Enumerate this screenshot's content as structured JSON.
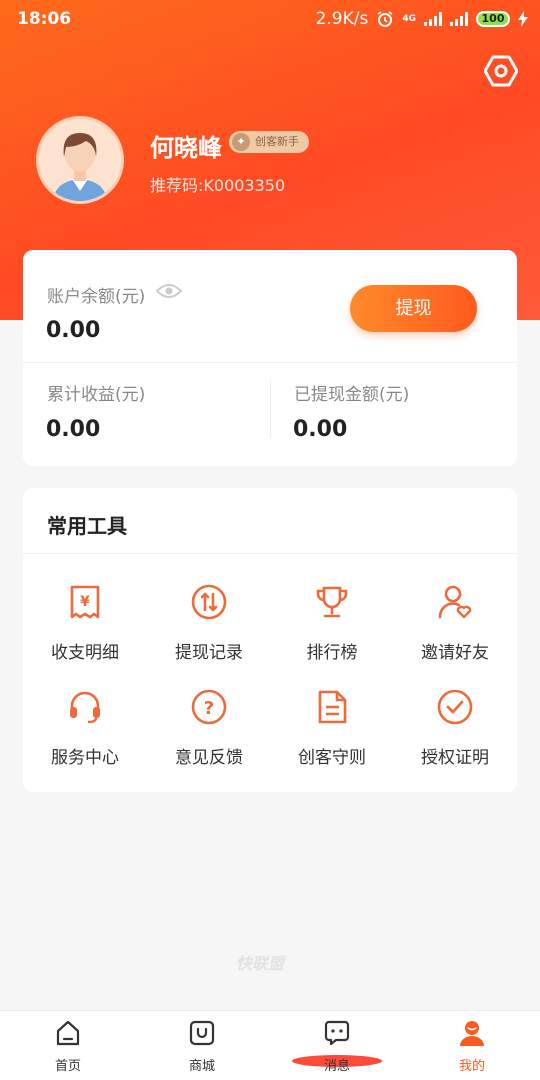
{
  "status_bar": {
    "time": "18:06",
    "network_speed": "2.9K/s",
    "network_type": "4G",
    "battery": "100"
  },
  "profile": {
    "name": "何晓峰",
    "badge": "创客新手",
    "referral_code": "推荐码:K0003350"
  },
  "balance": {
    "account_label": "账户余额(元)",
    "account_value": "0.00",
    "withdraw_button": "提现",
    "total_income_label": "累计收益(元)",
    "total_income_value": "0.00",
    "withdrawn_label": "已提现金额(元)",
    "withdrawn_value": "0.00"
  },
  "tools": {
    "title": "常用工具",
    "items": [
      {
        "label": "收支明细",
        "icon": "receipt-icon"
      },
      {
        "label": "提现记录",
        "icon": "transfer-icon"
      },
      {
        "label": "排行榜",
        "icon": "trophy-icon"
      },
      {
        "label": "邀请好友",
        "icon": "invite-friend-icon"
      },
      {
        "label": "服务中心",
        "icon": "headset-icon"
      },
      {
        "label": "意见反馈",
        "icon": "question-icon"
      },
      {
        "label": "创客守则",
        "icon": "document-icon"
      },
      {
        "label": "授权证明",
        "icon": "check-circle-icon"
      }
    ]
  },
  "watermark": "快联盟",
  "tabs": [
    {
      "label": "首页",
      "icon": "home-icon"
    },
    {
      "label": "商城",
      "icon": "shop-icon"
    },
    {
      "label": "消息",
      "icon": "message-icon"
    },
    {
      "label": "我的",
      "icon": "profile-icon",
      "active": true
    }
  ],
  "colors": {
    "accent": "#ff5a1e",
    "hero": "#ff4a24",
    "badge_bg": "#f1c9a3"
  }
}
